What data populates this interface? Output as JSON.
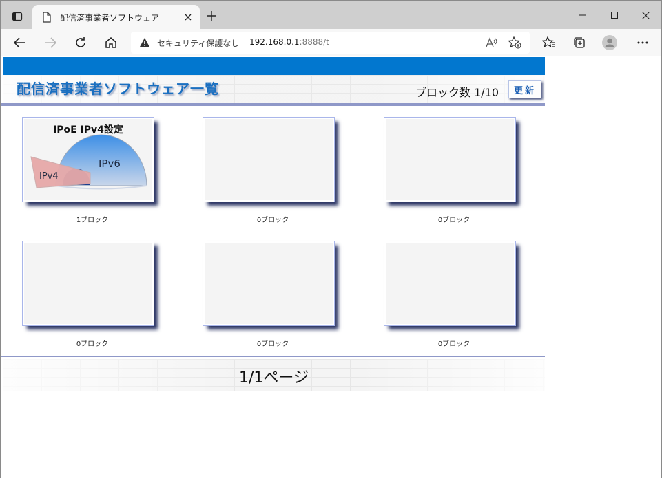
{
  "browser": {
    "tab_title": "配信済事業者ソフトウェア",
    "address": {
      "security_label": "セキュリティ保護なし",
      "host": "192.168.0.1",
      "path": ":8888/t"
    }
  },
  "page": {
    "title": "配信済事業者ソフトウェア一覧",
    "block_count": "ブロック数 1/10",
    "refresh_label": "更新",
    "cards": [
      {
        "title": "IPoE IPv4設定",
        "ipv6_label": "IPv6",
        "ipv4_label": "IPv4",
        "caption": "1ブロック"
      },
      {
        "title": "",
        "caption": "0ブロック"
      },
      {
        "title": "",
        "caption": "0ブロック"
      },
      {
        "title": "",
        "caption": "0ブロック"
      },
      {
        "title": "",
        "caption": "0ブロック"
      },
      {
        "title": "",
        "caption": "0ブロック"
      }
    ],
    "pager": "1/1ページ"
  },
  "colors": {
    "accent_blue": "#0277cf",
    "title_blue": "#1a6fc0",
    "rule": "#8f98c8"
  }
}
